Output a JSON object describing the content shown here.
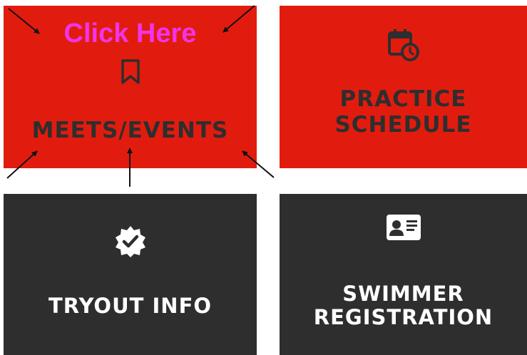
{
  "tiles": {
    "meets": {
      "title": "MEETS/EVENTS",
      "overlay": "Click Here",
      "icon": "bookmark-icon"
    },
    "practice": {
      "title": "PRACTICE\nSCHEDULE",
      "icon": "calendar-clock-icon"
    },
    "tryout": {
      "title": "TRYOUT INFO",
      "icon": "verified-badge-icon"
    },
    "swimmer": {
      "title": "SWIMMER\nREGISTRATION",
      "icon": "id-card-icon"
    }
  },
  "colors": {
    "red": "#e11c0e",
    "dark": "#2e2e2e",
    "highlight": "#f133ea"
  }
}
